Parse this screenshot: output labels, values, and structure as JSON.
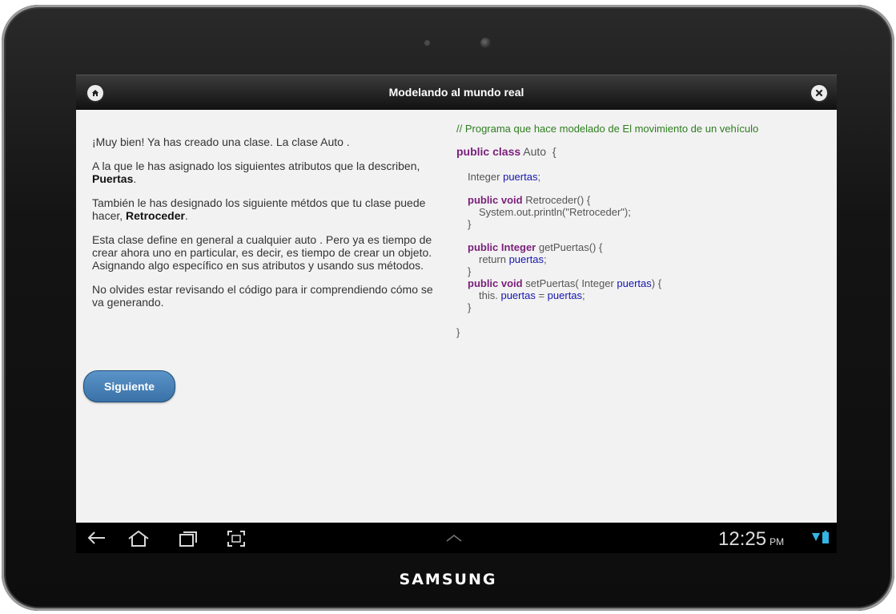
{
  "device": {
    "brand": "SAMSUNG"
  },
  "header": {
    "title": "Modelando al mundo real",
    "home_icon": "home-icon",
    "close_icon": "close-icon"
  },
  "intro": {
    "p1": "¡Muy bien! Ya has creado una clase. La clase Auto .",
    "p2_prefix": "A la que le has asignado los siguientes atributos que la describen, ",
    "p2_bold": "Puertas",
    "p2_suffix": ".",
    "p3_prefix": "También le has designado los siguiente métdos que tu clase puede hacer, ",
    "p3_bold": "Retroceder",
    "p3_suffix": ".",
    "p4": "Esta clase define en general a cualquier auto . Pero ya es tiempo de crear ahora uno en particular, es decir, es tiempo de crear un objeto. Asignando algo específico en sus atributos y usando sus métodos.",
    "p5": "No olvides estar revisando el código para ir comprendiendo cómo se va generando."
  },
  "code": {
    "comment": "// Programa que hace modelado de El movimiento de un vehículo",
    "class_kw": "public class",
    "class_name": " Auto  {",
    "field_type": "Integer ",
    "field_name": "puertas",
    "semicolon": ";",
    "m1_kw": "public void",
    "m1_sig": " Retroceder() {",
    "m1_body": "System.out.println(\"Retroceder\");",
    "close_brace": "}",
    "m2_kw": "public Integer",
    "m2_sig": " getPuertas() {",
    "m2_ret": "return ",
    "m3_kw": "public void",
    "m3_sig_a": " setPuertas( Integer ",
    "m3_sig_b": ") {",
    "m3_this": "this. ",
    "m3_eq": " = ",
    "class_close": "}"
  },
  "button": {
    "label": "Siguiente"
  },
  "status_bar": {
    "time": "12:25",
    "ampm": "PM"
  },
  "colors": {
    "comment": "#2e7d1f",
    "keyword": "#7a1f7a",
    "variable": "#1515b0",
    "button": "#3f78ad",
    "battery": "#33b5e5"
  }
}
